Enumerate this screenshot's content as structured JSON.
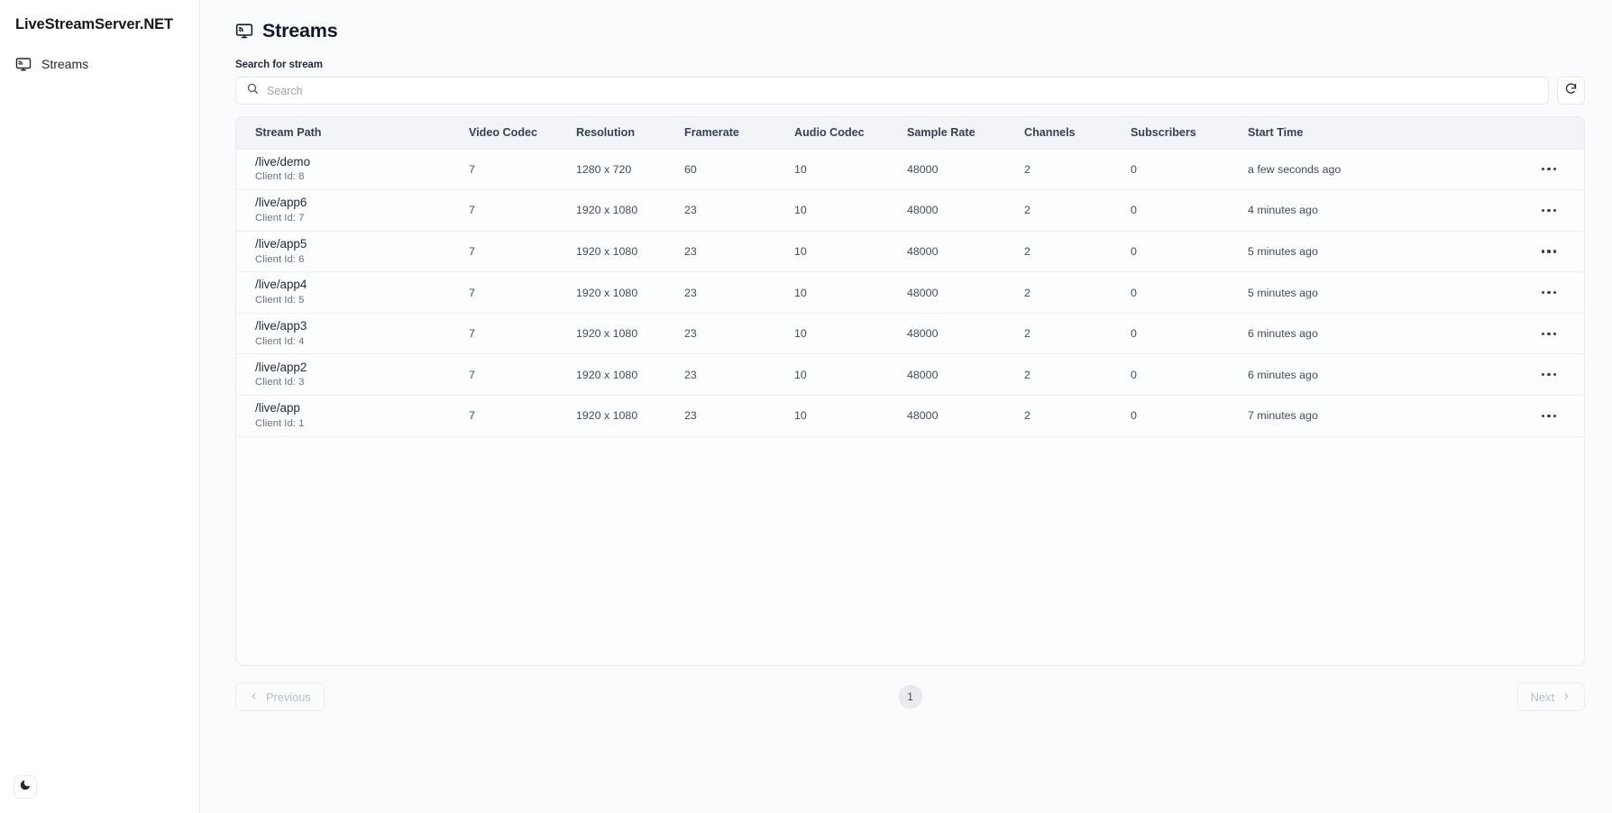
{
  "sidebar": {
    "brand": "LiveStreamServer.NET",
    "items": [
      {
        "label": "Streams",
        "icon": "cast-screen-icon"
      }
    ],
    "theme_toggle_icon": "moon-icon"
  },
  "header": {
    "title": "Streams",
    "title_icon": "cast-screen-icon"
  },
  "search": {
    "label": "Search for stream",
    "placeholder": "Search",
    "value": "",
    "icon": "search-icon",
    "refresh_icon": "refresh-icon"
  },
  "table": {
    "columns": [
      "Stream Path",
      "Video Codec",
      "Resolution",
      "Framerate",
      "Audio Codec",
      "Sample Rate",
      "Channels",
      "Subscribers",
      "Start Time"
    ],
    "row_action_icon": "ellipsis-icon",
    "rows": [
      {
        "stream_path": "/live/demo",
        "client_id": "Client Id: 8",
        "video_codec": "7",
        "resolution": "1280 x 720",
        "framerate": "60",
        "audio_codec": "10",
        "sample_rate": "48000",
        "channels": "2",
        "subscribers": "0",
        "start_time": "a few seconds ago"
      },
      {
        "stream_path": "/live/app6",
        "client_id": "Client Id: 7",
        "video_codec": "7",
        "resolution": "1920 x 1080",
        "framerate": "23",
        "audio_codec": "10",
        "sample_rate": "48000",
        "channels": "2",
        "subscribers": "0",
        "start_time": "4 minutes ago"
      },
      {
        "stream_path": "/live/app5",
        "client_id": "Client Id: 6",
        "video_codec": "7",
        "resolution": "1920 x 1080",
        "framerate": "23",
        "audio_codec": "10",
        "sample_rate": "48000",
        "channels": "2",
        "subscribers": "0",
        "start_time": "5 minutes ago"
      },
      {
        "stream_path": "/live/app4",
        "client_id": "Client Id: 5",
        "video_codec": "7",
        "resolution": "1920 x 1080",
        "framerate": "23",
        "audio_codec": "10",
        "sample_rate": "48000",
        "channels": "2",
        "subscribers": "0",
        "start_time": "5 minutes ago"
      },
      {
        "stream_path": "/live/app3",
        "client_id": "Client Id: 4",
        "video_codec": "7",
        "resolution": "1920 x 1080",
        "framerate": "23",
        "audio_codec": "10",
        "sample_rate": "48000",
        "channels": "2",
        "subscribers": "0",
        "start_time": "6 minutes ago"
      },
      {
        "stream_path": "/live/app2",
        "client_id": "Client Id: 3",
        "video_codec": "7",
        "resolution": "1920 x 1080",
        "framerate": "23",
        "audio_codec": "10",
        "sample_rate": "48000",
        "channels": "2",
        "subscribers": "0",
        "start_time": "6 minutes ago"
      },
      {
        "stream_path": "/live/app",
        "client_id": "Client Id: 1",
        "video_codec": "7",
        "resolution": "1920 x 1080",
        "framerate": "23",
        "audio_codec": "10",
        "sample_rate": "48000",
        "channels": "2",
        "subscribers": "0",
        "start_time": "7 minutes ago"
      }
    ]
  },
  "pagination": {
    "previous_label": "Previous",
    "next_label": "Next",
    "current_page": "1",
    "prev_icon": "chevron-left-icon",
    "next_icon": "chevron-right-icon"
  },
  "colors": {
    "page_background": "#fafbfc",
    "sidebar_background": "#ffffff",
    "table_header_background": "#f2f4f7",
    "border": "#e9ebf0",
    "text_primary": "#111827",
    "text_muted": "#6b7280"
  }
}
